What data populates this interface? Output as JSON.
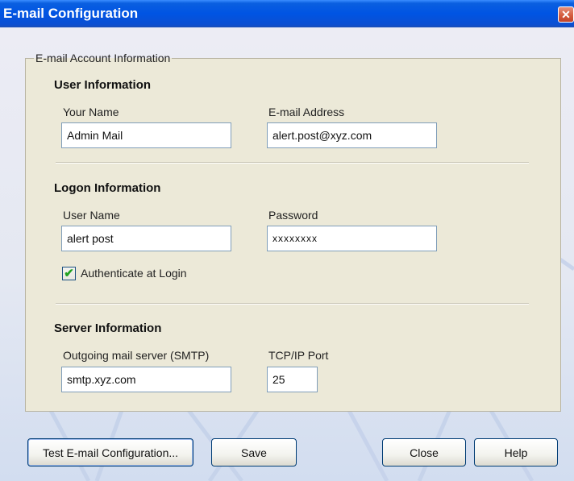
{
  "window": {
    "title": "E-mail Configuration",
    "close_glyph": "✕"
  },
  "group": {
    "title": "E-mail Account Information"
  },
  "user_info": {
    "title": "User Information",
    "name_label": "Your Name",
    "name_value": "Admin Mail",
    "email_label": "E-mail Address",
    "email_value": "alert.post@xyz.com"
  },
  "logon_info": {
    "title": "Logon Information",
    "username_label": "User Name",
    "username_value": "alert post",
    "password_label": "Password",
    "password_value": "xxxxxxxx",
    "auth_label": "Authenticate at Login",
    "auth_checked": true,
    "check_glyph": "✔"
  },
  "server_info": {
    "title": "Server Information",
    "smtp_label": "Outgoing mail server (SMTP)",
    "smtp_value": "smtp.xyz.com",
    "port_label": "TCP/IP Port",
    "port_value": "25"
  },
  "buttons": {
    "test": "Test E-mail Configuration...",
    "save": "Save",
    "close": "Close",
    "help": "Help"
  },
  "icons": {
    "close": "close-icon",
    "check": "check-icon"
  },
  "colors": {
    "titlebar": "#0054E3",
    "background": "#ECE9D8",
    "check": "#21A121"
  }
}
